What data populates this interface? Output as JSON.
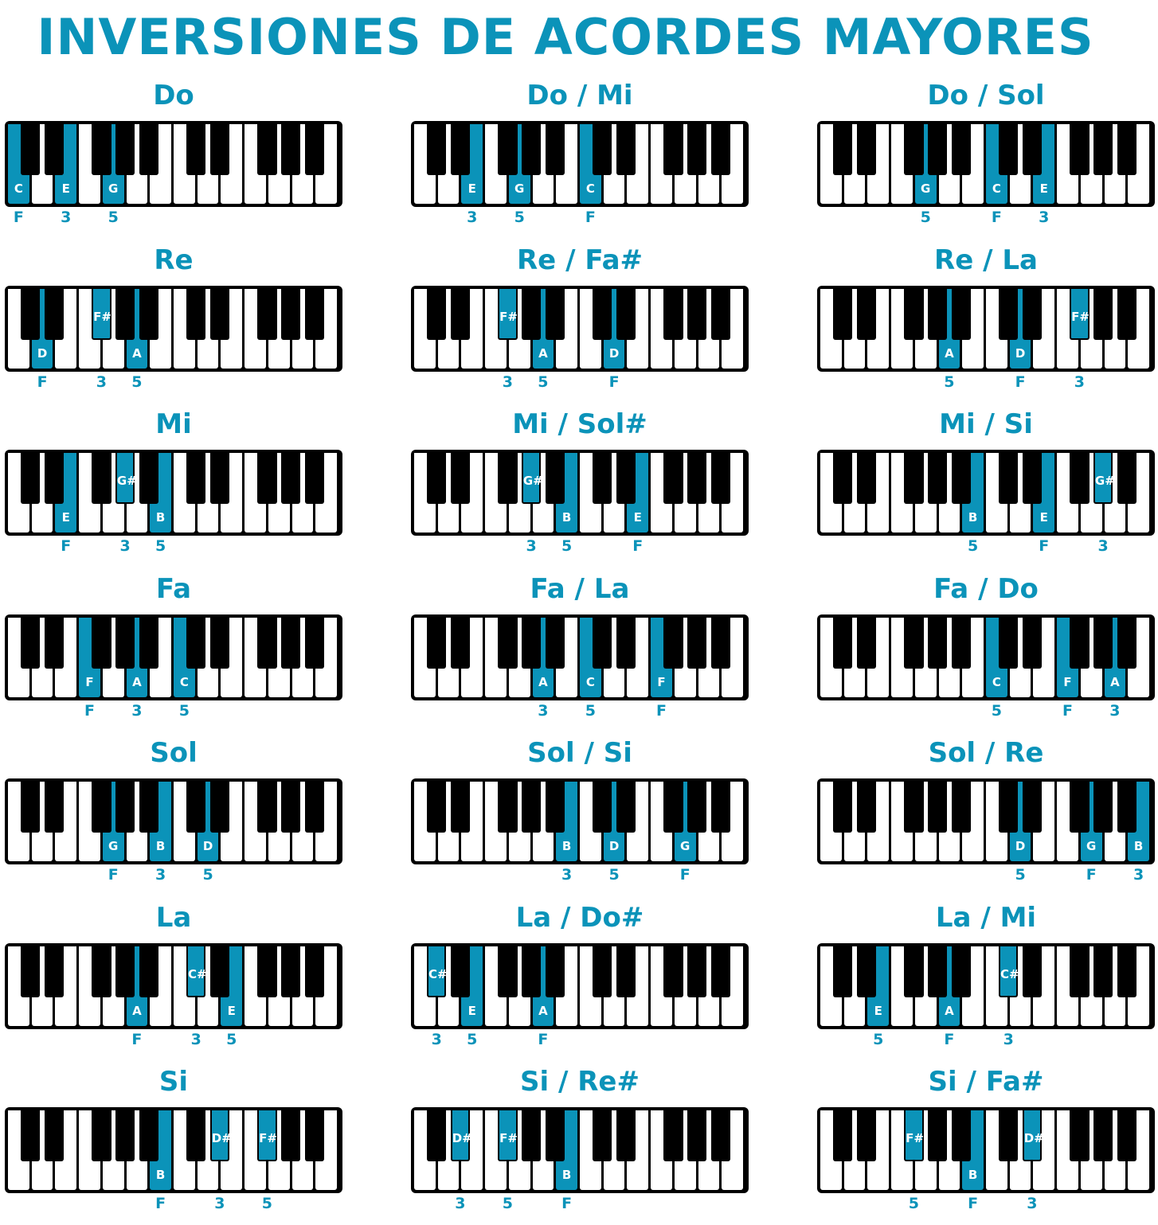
{
  "title": "INVERSIONES DE ACORDES MAYORES",
  "colors": {
    "accent": "#0b93b9",
    "black_key": "#000000",
    "white_key": "#ffffff"
  },
  "white_key_names": [
    "C",
    "D",
    "E",
    "F",
    "G",
    "A",
    "B",
    "C",
    "D",
    "E",
    "F",
    "G",
    "A",
    "B"
  ],
  "chords": [
    {
      "name": "Do",
      "notes": [
        {
          "semitone": 0,
          "label": "C",
          "degree": "F"
        },
        {
          "semitone": 4,
          "label": "E",
          "degree": "3"
        },
        {
          "semitone": 7,
          "label": "G",
          "degree": "5"
        }
      ]
    },
    {
      "name": "Do / Mi",
      "notes": [
        {
          "semitone": 4,
          "label": "E",
          "degree": "3"
        },
        {
          "semitone": 7,
          "label": "G",
          "degree": "5"
        },
        {
          "semitone": 12,
          "label": "C",
          "degree": "F"
        }
      ]
    },
    {
      "name": "Do / Sol",
      "notes": [
        {
          "semitone": 7,
          "label": "G",
          "degree": "5"
        },
        {
          "semitone": 12,
          "label": "C",
          "degree": "F"
        },
        {
          "semitone": 16,
          "label": "E",
          "degree": "3"
        }
      ]
    },
    {
      "name": "Re",
      "notes": [
        {
          "semitone": 2,
          "label": "D",
          "degree": "F"
        },
        {
          "semitone": 6,
          "label": "F#",
          "degree": "3"
        },
        {
          "semitone": 9,
          "label": "A",
          "degree": "5"
        }
      ]
    },
    {
      "name": "Re / Fa#",
      "notes": [
        {
          "semitone": 6,
          "label": "F#",
          "degree": "3"
        },
        {
          "semitone": 9,
          "label": "A",
          "degree": "5"
        },
        {
          "semitone": 14,
          "label": "D",
          "degree": "F"
        }
      ]
    },
    {
      "name": "Re / La",
      "notes": [
        {
          "semitone": 9,
          "label": "A",
          "degree": "5"
        },
        {
          "semitone": 14,
          "label": "D",
          "degree": "F"
        },
        {
          "semitone": 18,
          "label": "F#",
          "degree": "3"
        }
      ]
    },
    {
      "name": "Mi",
      "notes": [
        {
          "semitone": 4,
          "label": "E",
          "degree": "F"
        },
        {
          "semitone": 8,
          "label": "G#",
          "degree": "3"
        },
        {
          "semitone": 11,
          "label": "B",
          "degree": "5"
        }
      ]
    },
    {
      "name": "Mi / Sol#",
      "notes": [
        {
          "semitone": 8,
          "label": "G#",
          "degree": "3"
        },
        {
          "semitone": 11,
          "label": "B",
          "degree": "5"
        },
        {
          "semitone": 16,
          "label": "E",
          "degree": "F"
        }
      ]
    },
    {
      "name": "Mi / Si",
      "notes": [
        {
          "semitone": 11,
          "label": "B",
          "degree": "5"
        },
        {
          "semitone": 16,
          "label": "E",
          "degree": "F"
        },
        {
          "semitone": 20,
          "label": "G#",
          "degree": "3"
        }
      ]
    },
    {
      "name": "Fa",
      "notes": [
        {
          "semitone": 5,
          "label": "F",
          "degree": "F"
        },
        {
          "semitone": 9,
          "label": "A",
          "degree": "3"
        },
        {
          "semitone": 12,
          "label": "C",
          "degree": "5"
        }
      ]
    },
    {
      "name": "Fa / La",
      "notes": [
        {
          "semitone": 9,
          "label": "A",
          "degree": "3"
        },
        {
          "semitone": 12,
          "label": "C",
          "degree": "5"
        },
        {
          "semitone": 17,
          "label": "F",
          "degree": "F"
        }
      ]
    },
    {
      "name": "Fa / Do",
      "notes": [
        {
          "semitone": 12,
          "label": "C",
          "degree": "5"
        },
        {
          "semitone": 17,
          "label": "F",
          "degree": "F"
        },
        {
          "semitone": 21,
          "label": "A",
          "degree": "3"
        }
      ]
    },
    {
      "name": "Sol",
      "notes": [
        {
          "semitone": 7,
          "label": "G",
          "degree": "F"
        },
        {
          "semitone": 11,
          "label": "B",
          "degree": "3"
        },
        {
          "semitone": 14,
          "label": "D",
          "degree": "5"
        }
      ]
    },
    {
      "name": "Sol / Si",
      "notes": [
        {
          "semitone": 11,
          "label": "B",
          "degree": "3"
        },
        {
          "semitone": 14,
          "label": "D",
          "degree": "5"
        },
        {
          "semitone": 19,
          "label": "G",
          "degree": "F"
        }
      ]
    },
    {
      "name": "Sol / Re",
      "notes": [
        {
          "semitone": 14,
          "label": "D",
          "degree": "5"
        },
        {
          "semitone": 19,
          "label": "G",
          "degree": "F"
        },
        {
          "semitone": 23,
          "label": "B",
          "degree": "3"
        }
      ]
    },
    {
      "name": "La",
      "notes": [
        {
          "semitone": 9,
          "label": "A",
          "degree": "F"
        },
        {
          "semitone": 13,
          "label": "C#",
          "degree": "3"
        },
        {
          "semitone": 16,
          "label": "E",
          "degree": "5"
        }
      ]
    },
    {
      "name": "La / Do#",
      "notes": [
        {
          "semitone": 1,
          "label": "C#",
          "degree": "3"
        },
        {
          "semitone": 4,
          "label": "E",
          "degree": "5"
        },
        {
          "semitone": 9,
          "label": "A",
          "degree": "F"
        }
      ]
    },
    {
      "name": "La / Mi",
      "notes": [
        {
          "semitone": 4,
          "label": "E",
          "degree": "5"
        },
        {
          "semitone": 9,
          "label": "A",
          "degree": "F"
        },
        {
          "semitone": 13,
          "label": "C#",
          "degree": "3"
        }
      ]
    },
    {
      "name": "Si",
      "notes": [
        {
          "semitone": 11,
          "label": "B",
          "degree": "F"
        },
        {
          "semitone": 15,
          "label": "D#",
          "degree": "3"
        },
        {
          "semitone": 18,
          "label": "F#",
          "degree": "5"
        }
      ]
    },
    {
      "name": "Si / Re#",
      "notes": [
        {
          "semitone": 3,
          "label": "D#",
          "degree": "3"
        },
        {
          "semitone": 6,
          "label": "F#",
          "degree": "5"
        },
        {
          "semitone": 11,
          "label": "B",
          "degree": "F"
        }
      ]
    },
    {
      "name": "Si / Fa#",
      "notes": [
        {
          "semitone": 6,
          "label": "F#",
          "degree": "5"
        },
        {
          "semitone": 11,
          "label": "B",
          "degree": "F"
        },
        {
          "semitone": 15,
          "label": "D#",
          "degree": "3"
        }
      ]
    }
  ]
}
